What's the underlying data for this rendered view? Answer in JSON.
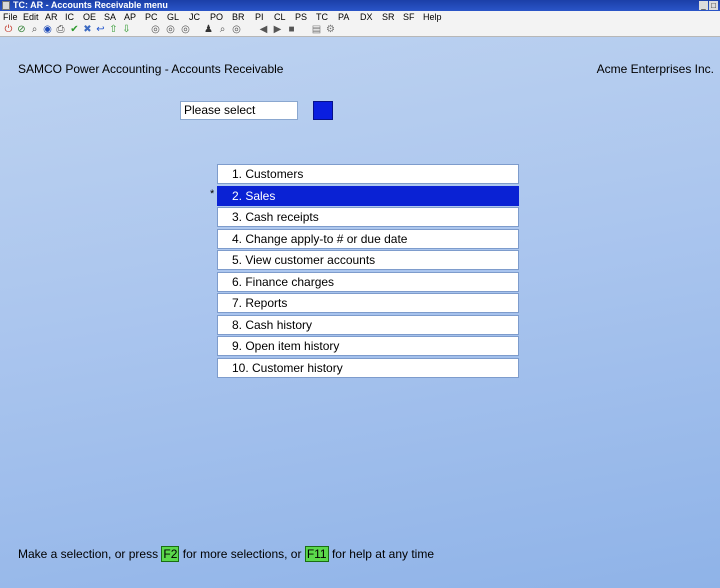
{
  "window": {
    "title": "TC: AR - Accounts Receivable menu",
    "controls": [
      "_",
      "□"
    ]
  },
  "menubar": [
    "File",
    "Edit",
    "AR",
    "IC",
    "OE",
    "SA",
    "AP",
    "PC",
    "GL",
    "JC",
    "PO",
    "BR",
    "PI",
    "CL",
    "PS",
    "TC",
    "PA",
    "DX",
    "SR",
    "SF",
    "Help"
  ],
  "toolbar": {
    "icons": [
      "exit-icon",
      "stop-icon",
      "find-icon",
      "globe-icon",
      "print-icon",
      "check-icon",
      "delete-icon",
      "undo-icon",
      "up-icon",
      "down-icon",
      "first-icon",
      "prev-icon",
      "next-icon",
      "binoculars-icon",
      "zoom-icon",
      "record-icon",
      "back-icon",
      "forward-icon",
      "last-icon",
      "calculator-icon",
      "options-icon"
    ],
    "glyphs": [
      "⏻",
      "⊘",
      "⌕",
      "◉",
      "⎙",
      "✔",
      "✖",
      "↩",
      "⇧",
      "⇩",
      "◎",
      "◎",
      "◎",
      "♟",
      "⌕",
      "◎",
      "◀",
      "▶",
      "■",
      "▤",
      "⚙"
    ]
  },
  "header": {
    "app_title": "SAMCO Power Accounting - Accounts Receivable",
    "company": "Acme Enterprises Inc."
  },
  "prompt": {
    "label": "Please select",
    "value": ""
  },
  "menu": {
    "items": [
      {
        "label": "1. Customers"
      },
      {
        "label": "2. Sales",
        "selected": true,
        "marker": "*"
      },
      {
        "label": "3. Cash receipts"
      },
      {
        "label": "4. Change apply-to # or due date"
      },
      {
        "label": "5. View customer accounts"
      },
      {
        "label": "6. Finance charges"
      },
      {
        "label": "7. Reports"
      },
      {
        "label": "8. Cash history"
      },
      {
        "label": "9. Open item history"
      },
      {
        "label": "10. Customer history"
      }
    ]
  },
  "status": {
    "part1": "Make a selection, or press ",
    "key1": "F2",
    "part2": " for more selections, or ",
    "key2": "F11",
    "part3": " for help at any time"
  },
  "colors": {
    "selected": "#0a22d4",
    "key_highlight": "#5bd84b",
    "background": "#aac5ee"
  }
}
